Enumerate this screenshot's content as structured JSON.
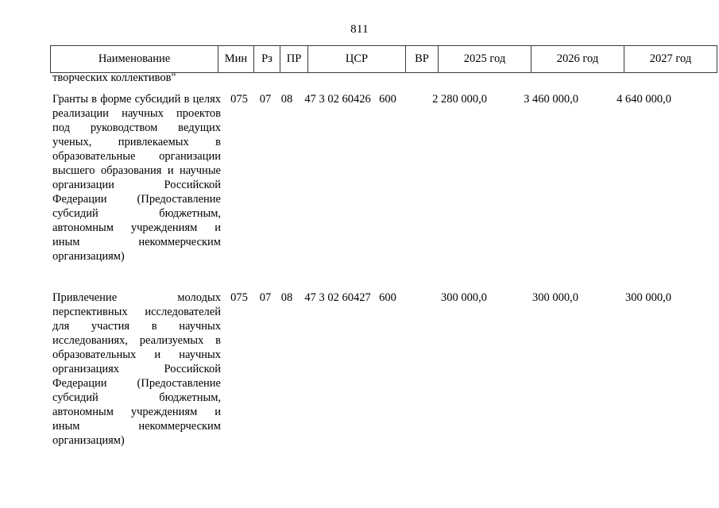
{
  "page": {
    "number": "811"
  },
  "continuation_fragment": "творческих коллективов\"",
  "table": {
    "headers": {
      "name": "Наименование",
      "min": "Мин",
      "rz": "Рз",
      "pr": "ПР",
      "csr": "ЦСР",
      "vr": "ВР",
      "year_2025": "2025 год",
      "year_2026": "2026 год",
      "year_2027": "2027 год"
    },
    "rows": [
      {
        "description_body": "Гранты в форме субсидий в целях реализации научных проектов под руководством ведущих ученых, привлекаемых в образовательные организации высшего образования и научные организации Российской Федерации (Предоставление субсидий бюджетным, автономным учреждениям и иным некоммерческим",
        "description_tail": "организациям)",
        "min": "075",
        "rz": "07",
        "pr": "08",
        "csr": "47 3 02 60426",
        "vr": "600",
        "year_2025": "2 280 000,0",
        "year_2026": "3 460 000,0",
        "year_2027": "4 640 000,0"
      },
      {
        "description_body": "Привлечение молодых перспективных исследователей для участия в научных исследованиях, реализуемых в образовательных и научных организациях Российской Федерации (Предоставление субсидий бюджетным, автономным учреждениям и иным некоммерческим",
        "description_tail": "организациям)",
        "min": "075",
        "rz": "07",
        "pr": "08",
        "csr": "47 3 02 60427",
        "vr": "600",
        "year_2025": "300 000,0",
        "year_2026": "300 000,0",
        "year_2027": "300 000,0"
      }
    ]
  }
}
